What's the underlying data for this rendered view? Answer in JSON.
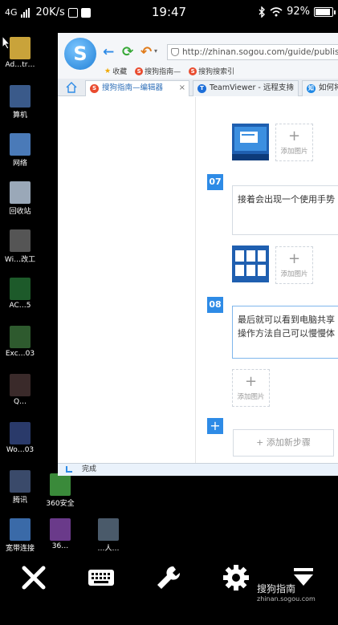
{
  "status_bar": {
    "network": "4G",
    "speed": "20K/s",
    "time": "19:47",
    "battery": "92%"
  },
  "desktop_icons": [
    {
      "label": "Ad…tr…",
      "color": "#c9a33a"
    },
    {
      "label": "算机",
      "color": "#3a5a8a"
    },
    {
      "label": "网络",
      "color": "#4a7ab8"
    },
    {
      "label": "回收站",
      "color": "#9aa8b8"
    },
    {
      "label": "Wi…改工",
      "color": "#555"
    },
    {
      "label": "AC…5",
      "color": "#1d5a2a"
    },
    {
      "label": "Exc…03",
      "color": "#2e5a2e"
    },
    {
      "label": "Q…",
      "color": "#3a2a2a"
    },
    {
      "label": "Wo…03",
      "color": "#2a3a6a"
    },
    {
      "label": "腾讯",
      "color": "#3a4a6a"
    },
    {
      "label": "360安全",
      "color": "#3a8a3a"
    },
    {
      "label": "宽带连接",
      "color": "#3a6aa8"
    },
    {
      "label": "36…",
      "color": "#6a3a8a"
    },
    {
      "label": "…人…",
      "color": "#4a5a6a"
    }
  ],
  "browser": {
    "url": "http://zhinan.sogou.com/guide/publish",
    "favorites": [
      "收藏",
      "搜狗指南—",
      "搜狗搜索引"
    ],
    "tabs": [
      {
        "label": "搜狗指南—编辑器",
        "active": true,
        "icon_color": "#e94b2f",
        "icon_text": "S"
      },
      {
        "label": "TeamViewer - 远程支持",
        "active": false,
        "icon_color": "#1e6fd9",
        "icon_text": "T"
      },
      {
        "label": "如何将",
        "active": false,
        "icon_color": "#1e88e5",
        "icon_text": "知"
      }
    ],
    "status_text": "完成"
  },
  "editor": {
    "step7": {
      "number": "07",
      "text": "接着会出现一个使用手势"
    },
    "step8": {
      "number": "08",
      "text_line1": "最后就可以看到电脑共享",
      "text_line2": "操作方法自己可以慢慢体"
    },
    "add_image_label": "添加图片",
    "add_image_plus": "+",
    "add_step_label": "+ 添加新步骤",
    "add_step_plus": "+"
  },
  "watermark": {
    "brand": "搜狗指南",
    "domain": "zhinan.sogou.com"
  }
}
